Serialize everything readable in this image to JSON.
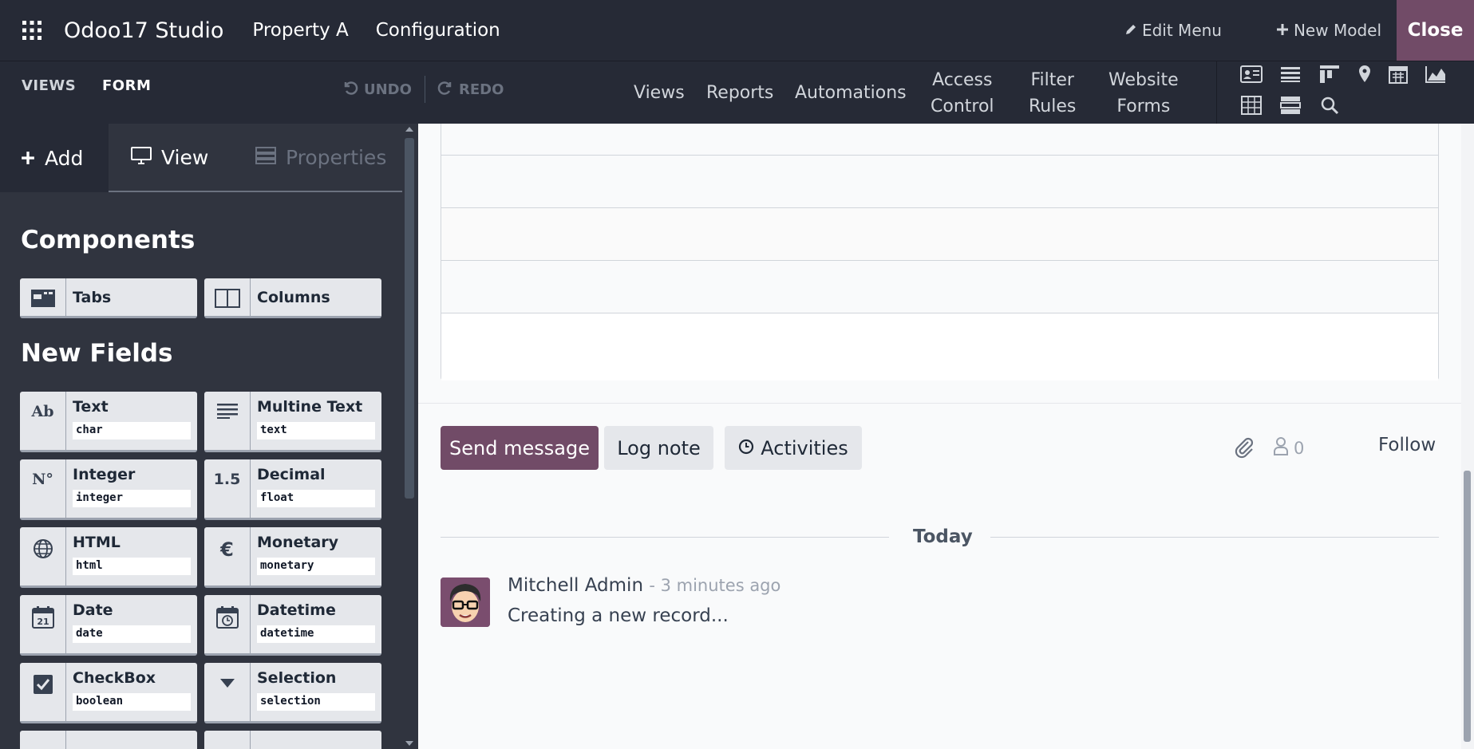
{
  "topbar": {
    "app_title": "Odoo17 Studio",
    "menus": [
      "Property A",
      "Configuration"
    ],
    "edit_menu": "Edit Menu",
    "new_model": "New Model",
    "close": "Close"
  },
  "subbar": {
    "tabs": [
      "VIEWS",
      "FORM"
    ],
    "undo": "UNDO",
    "redo": "REDO",
    "menu": {
      "views": "Views",
      "reports": "Reports",
      "automations": "Automations",
      "access_1": "Access",
      "access_2": "Control",
      "filter_1": "Filter",
      "filter_2": "Rules",
      "website_1": "Website",
      "website_2": "Forms"
    }
  },
  "sidebar": {
    "tabs": {
      "add": "Add",
      "view": "View",
      "properties": "Properties"
    },
    "components_title": "Components",
    "components": [
      {
        "label": "Tabs",
        "icon": "tabs-icon"
      },
      {
        "label": "Columns",
        "icon": "columns-icon"
      }
    ],
    "new_fields_title": "New Fields",
    "fields": [
      {
        "label": "Text",
        "type": "char",
        "icon_text": "Ab"
      },
      {
        "label": "Multine Text",
        "type": "text",
        "icon_text": ""
      },
      {
        "label": "Integer",
        "type": "integer",
        "icon_text": "N°"
      },
      {
        "label": "Decimal",
        "type": "float",
        "icon_text": "1.5"
      },
      {
        "label": "HTML",
        "type": "html",
        "icon_text": ""
      },
      {
        "label": "Monetary",
        "type": "monetary",
        "icon_text": "€"
      },
      {
        "label": "Date",
        "type": "date",
        "icon_text": "21"
      },
      {
        "label": "Datetime",
        "type": "datetime",
        "icon_text": ""
      },
      {
        "label": "CheckBox",
        "type": "boolean",
        "icon_text": ""
      },
      {
        "label": "Selection",
        "type": "selection",
        "icon_text": ""
      }
    ]
  },
  "chatter": {
    "send_message": "Send message",
    "log_note": "Log note",
    "activities": "Activities",
    "followers_count": "0",
    "follow": "Follow",
    "today": "Today",
    "author": "Mitchell Admin",
    "time_ago": "- 3 minutes ago",
    "message": "Creating a new record..."
  },
  "colors": {
    "brand": "#714b67",
    "navbar": "#262a36",
    "sidebar": "#30343f"
  }
}
